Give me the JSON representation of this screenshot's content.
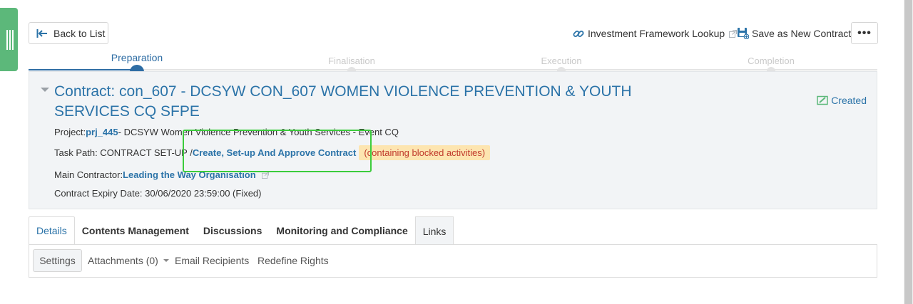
{
  "toolbar": {
    "back_label": "Back to List",
    "investment_lookup_label": "Investment Framework Lookup",
    "save_new_label": "Save as New Contract",
    "more_label": "•••"
  },
  "stepper": {
    "steps": [
      {
        "label": "Preparation",
        "active": true
      },
      {
        "label": "Finalisation",
        "active": false
      },
      {
        "label": "Execution",
        "active": false
      },
      {
        "label": "Completion",
        "active": false
      }
    ]
  },
  "contract": {
    "title": "Contract: con_607 - DCSYW CON_607 WOMEN VIOLENCE PREVENTION & YOUTH SERVICES CQ SFPE",
    "status": "Created",
    "project_label": "Project:",
    "project_id": "prj_445",
    "project_name": "- DCSYW Women Violence Prevention & Youth Services - Event CQ",
    "task_path_label": "Task Path: CONTRACT SET-UP /",
    "task_path_link": "Create, Set-up And Approve Contract",
    "blocked_badge": "(containing blocked activities)",
    "main_contractor_label": "Main Contractor:",
    "main_contractor": "Leading the Way Organisation",
    "expiry": "Contract Expiry Date: 30/06/2020 23:59:00 (Fixed)"
  },
  "tabs": [
    "Details",
    "Contents Management",
    "Discussions",
    "Monitoring and Compliance",
    "Links"
  ],
  "subtabs": {
    "settings": "Settings",
    "attachments": "Attachments (0)",
    "email": "Email Recipients",
    "redefine": "Redefine Rights"
  },
  "colors": {
    "accent": "#2b73a8",
    "side_handle": "#5cb87a",
    "highlight": "#3ccc3c",
    "blocked_bg": "#fde5b0"
  }
}
